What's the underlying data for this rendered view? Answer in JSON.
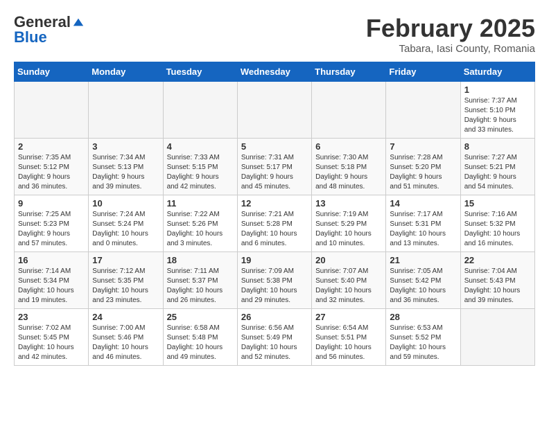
{
  "header": {
    "logo_general": "General",
    "logo_blue": "Blue",
    "month_title": "February 2025",
    "location": "Tabara, Iasi County, Romania"
  },
  "weekdays": [
    "Sunday",
    "Monday",
    "Tuesday",
    "Wednesday",
    "Thursday",
    "Friday",
    "Saturday"
  ],
  "weeks": [
    [
      {
        "day": "",
        "empty": true
      },
      {
        "day": "",
        "empty": true
      },
      {
        "day": "",
        "empty": true
      },
      {
        "day": "",
        "empty": true
      },
      {
        "day": "",
        "empty": true
      },
      {
        "day": "",
        "empty": true
      },
      {
        "day": "1",
        "info": "Sunrise: 7:37 AM\nSunset: 5:10 PM\nDaylight: 9 hours\nand 33 minutes."
      }
    ],
    [
      {
        "day": "2",
        "info": "Sunrise: 7:35 AM\nSunset: 5:12 PM\nDaylight: 9 hours\nand 36 minutes."
      },
      {
        "day": "3",
        "info": "Sunrise: 7:34 AM\nSunset: 5:13 PM\nDaylight: 9 hours\nand 39 minutes."
      },
      {
        "day": "4",
        "info": "Sunrise: 7:33 AM\nSunset: 5:15 PM\nDaylight: 9 hours\nand 42 minutes."
      },
      {
        "day": "5",
        "info": "Sunrise: 7:31 AM\nSunset: 5:17 PM\nDaylight: 9 hours\nand 45 minutes."
      },
      {
        "day": "6",
        "info": "Sunrise: 7:30 AM\nSunset: 5:18 PM\nDaylight: 9 hours\nand 48 minutes."
      },
      {
        "day": "7",
        "info": "Sunrise: 7:28 AM\nSunset: 5:20 PM\nDaylight: 9 hours\nand 51 minutes."
      },
      {
        "day": "8",
        "info": "Sunrise: 7:27 AM\nSunset: 5:21 PM\nDaylight: 9 hours\nand 54 minutes."
      }
    ],
    [
      {
        "day": "9",
        "info": "Sunrise: 7:25 AM\nSunset: 5:23 PM\nDaylight: 9 hours\nand 57 minutes."
      },
      {
        "day": "10",
        "info": "Sunrise: 7:24 AM\nSunset: 5:24 PM\nDaylight: 10 hours\nand 0 minutes."
      },
      {
        "day": "11",
        "info": "Sunrise: 7:22 AM\nSunset: 5:26 PM\nDaylight: 10 hours\nand 3 minutes."
      },
      {
        "day": "12",
        "info": "Sunrise: 7:21 AM\nSunset: 5:28 PM\nDaylight: 10 hours\nand 6 minutes."
      },
      {
        "day": "13",
        "info": "Sunrise: 7:19 AM\nSunset: 5:29 PM\nDaylight: 10 hours\nand 10 minutes."
      },
      {
        "day": "14",
        "info": "Sunrise: 7:17 AM\nSunset: 5:31 PM\nDaylight: 10 hours\nand 13 minutes."
      },
      {
        "day": "15",
        "info": "Sunrise: 7:16 AM\nSunset: 5:32 PM\nDaylight: 10 hours\nand 16 minutes."
      }
    ],
    [
      {
        "day": "16",
        "info": "Sunrise: 7:14 AM\nSunset: 5:34 PM\nDaylight: 10 hours\nand 19 minutes."
      },
      {
        "day": "17",
        "info": "Sunrise: 7:12 AM\nSunset: 5:35 PM\nDaylight: 10 hours\nand 23 minutes."
      },
      {
        "day": "18",
        "info": "Sunrise: 7:11 AM\nSunset: 5:37 PM\nDaylight: 10 hours\nand 26 minutes."
      },
      {
        "day": "19",
        "info": "Sunrise: 7:09 AM\nSunset: 5:38 PM\nDaylight: 10 hours\nand 29 minutes."
      },
      {
        "day": "20",
        "info": "Sunrise: 7:07 AM\nSunset: 5:40 PM\nDaylight: 10 hours\nand 32 minutes."
      },
      {
        "day": "21",
        "info": "Sunrise: 7:05 AM\nSunset: 5:42 PM\nDaylight: 10 hours\nand 36 minutes."
      },
      {
        "day": "22",
        "info": "Sunrise: 7:04 AM\nSunset: 5:43 PM\nDaylight: 10 hours\nand 39 minutes."
      }
    ],
    [
      {
        "day": "23",
        "info": "Sunrise: 7:02 AM\nSunset: 5:45 PM\nDaylight: 10 hours\nand 42 minutes."
      },
      {
        "day": "24",
        "info": "Sunrise: 7:00 AM\nSunset: 5:46 PM\nDaylight: 10 hours\nand 46 minutes."
      },
      {
        "day": "25",
        "info": "Sunrise: 6:58 AM\nSunset: 5:48 PM\nDaylight: 10 hours\nand 49 minutes."
      },
      {
        "day": "26",
        "info": "Sunrise: 6:56 AM\nSunset: 5:49 PM\nDaylight: 10 hours\nand 52 minutes."
      },
      {
        "day": "27",
        "info": "Sunrise: 6:54 AM\nSunset: 5:51 PM\nDaylight: 10 hours\nand 56 minutes."
      },
      {
        "day": "28",
        "info": "Sunrise: 6:53 AM\nSunset: 5:52 PM\nDaylight: 10 hours\nand 59 minutes."
      },
      {
        "day": "",
        "empty": true
      }
    ]
  ]
}
